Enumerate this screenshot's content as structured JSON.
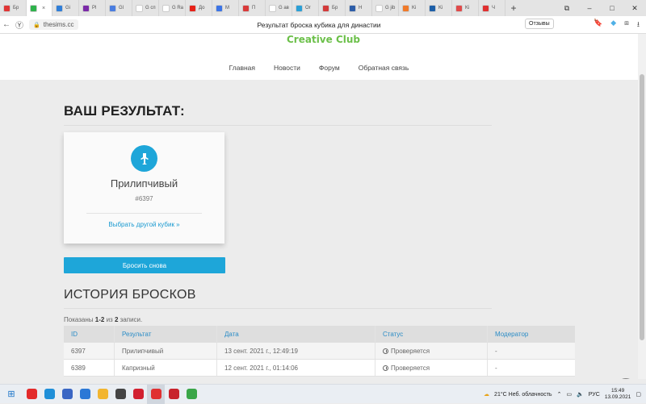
{
  "browser": {
    "tabs": [
      {
        "label": "Бр",
        "color": "#e03535"
      },
      {
        "label": "",
        "color": "#2eb24b",
        "active": true
      },
      {
        "label": "Gi",
        "color": "#2f7ed8"
      },
      {
        "label": "Pl",
        "color": "#7b2aa8"
      },
      {
        "label": "Gl",
        "color": "#4a7de0"
      },
      {
        "label": "G сп",
        "color": "#ffffff"
      },
      {
        "label": "G Ra",
        "color": "#ffffff"
      },
      {
        "label": "До",
        "color": "#e62117"
      },
      {
        "label": "M",
        "color": "#3b74e6"
      },
      {
        "label": "П",
        "color": "#d93a3a"
      },
      {
        "label": "G ав",
        "color": "#ffffff"
      },
      {
        "label": "Or",
        "color": "#2a9fd6"
      },
      {
        "label": "Бр",
        "color": "#d33a3a"
      },
      {
        "label": "Н",
        "color": "#2d5da8"
      },
      {
        "label": "G jib",
        "color": "#ffffff"
      },
      {
        "label": "Ki",
        "color": "#f07a2a"
      },
      {
        "label": "Ki",
        "color": "#1d5fa8"
      },
      {
        "label": "Ki",
        "color": "#e04a4a"
      },
      {
        "label": "Ч",
        "color": "#e03030"
      }
    ],
    "close_glyph": "×",
    "new_tab_glyph": "+",
    "url": "thesims.cc",
    "page_title": "Результат броска кубика для династии",
    "reviews_label": "Отзывы"
  },
  "site": {
    "logo": "Creative Club",
    "nav": [
      "Главная",
      "Новости",
      "Форум",
      "Обратная связь"
    ]
  },
  "result": {
    "heading": "ВАШ РЕЗУЛЬТАТ:",
    "name": "Прилипчивый",
    "id": "#6397",
    "choose_link": "Выбрать другой кубик »",
    "roll_again": "Бросить снова",
    "icon": "cube-icon"
  },
  "history": {
    "title": "ИСТОРИЯ БРОСКОВ",
    "shown_prefix": "Показаны",
    "shown_range": "1-2",
    "shown_of": "из",
    "shown_total": "2",
    "shown_suffix": "записи.",
    "columns": [
      "ID",
      "Результат",
      "Дата",
      "Статус",
      "Модератор"
    ],
    "rows": [
      {
        "id": "6397",
        "result": "Прилипчивый",
        "date": "13 сент. 2021 г., 12:49:19",
        "status": "Проверяется",
        "moderator": "-"
      },
      {
        "id": "6389",
        "result": "Капризный",
        "date": "12 сент. 2021 г., 01:14:06",
        "status": "Проверяется",
        "moderator": "-"
      }
    ]
  },
  "taskbar": {
    "weather": "21°C  Неб. облачность",
    "lang": "РУС",
    "time": "15:49",
    "date": "13.09.2021",
    "apps": [
      {
        "name": "yandex",
        "color": "#e32b2b"
      },
      {
        "name": "edge",
        "color": "#1f8fd8"
      },
      {
        "name": "store",
        "color": "#3a66c4"
      },
      {
        "name": "mail",
        "color": "#2b78d6"
      },
      {
        "name": "files",
        "color": "#f2b530"
      },
      {
        "name": "game",
        "color": "#444444"
      },
      {
        "name": "opera",
        "color": "#d22030"
      },
      {
        "name": "yandex-browser",
        "color": "#e03131",
        "active": true
      },
      {
        "name": "pinterest",
        "color": "#c8232c"
      },
      {
        "name": "sims",
        "color": "#3aa648"
      }
    ]
  }
}
